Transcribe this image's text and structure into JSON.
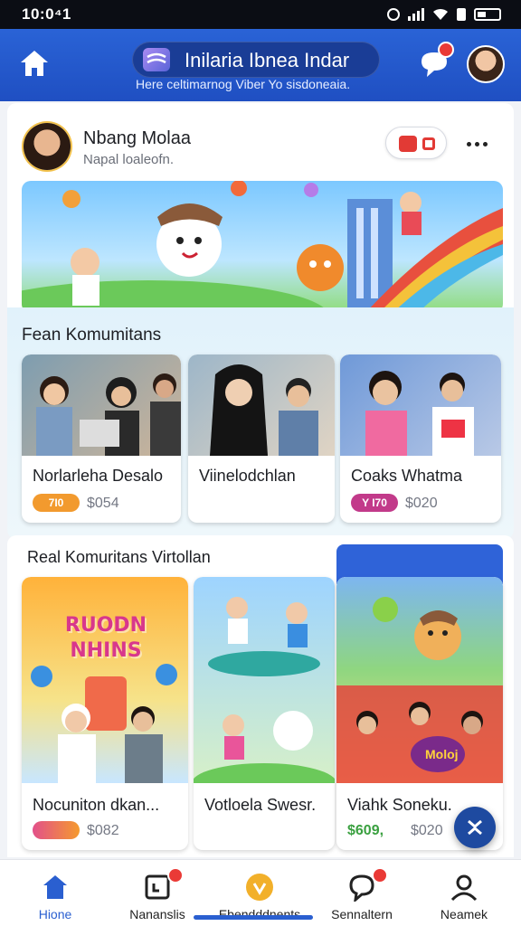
{
  "status": {
    "time": "10:0⁴1"
  },
  "header": {
    "title": "Inilaria Ibnea Indar",
    "subtitle": "Here celtimarnog Viber Yo sisdoneaia."
  },
  "post": {
    "author": "Nbang Molaa",
    "author_sub": "Napal loaleofn."
  },
  "section1": {
    "title": "Fean Komumitans",
    "cards": [
      {
        "title": "Norlarleha Desalo",
        "pill": "7I0",
        "pill_color": "#f29a2e",
        "price": "$054"
      },
      {
        "title": "Viinelodchlan",
        "pill": "",
        "pill_color": "",
        "price": ""
      },
      {
        "title": "Coaks Whatma",
        "pill": "Y I70",
        "pill_color": "#c23a8a",
        "price": "$020"
      }
    ]
  },
  "section2": {
    "title": "Real Komuritans Virtollan",
    "cards": [
      {
        "title": "Nocuniton dkan...",
        "art_text": "RUODN NHINS",
        "pill": "",
        "pill_color": "#d247a8",
        "price": "$082"
      },
      {
        "title": "Votloela Swesr.",
        "price": ""
      },
      {
        "title": "Viahk Soneku.",
        "price_green": "$609,",
        "price": "$020",
        "chip": "Moloj"
      }
    ]
  },
  "bottom_nav": [
    {
      "label": "Hione",
      "icon": "home-icon",
      "active": true
    },
    {
      "label": "Nananslis",
      "icon": "calendar-icon"
    },
    {
      "label": "Ebendddnents",
      "icon": "coin-icon"
    },
    {
      "label": "Sennaltern",
      "icon": "chat-bubble-icon"
    },
    {
      "label": "Neamek",
      "icon": "profile-icon"
    }
  ],
  "colors": {
    "brand": "#2a63d6",
    "badge": "#ea3a36",
    "nav_active": "#2a5fd0"
  }
}
